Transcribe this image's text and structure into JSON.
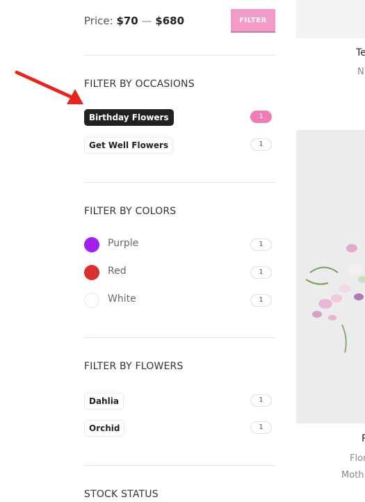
{
  "price_filter": {
    "label": "Price:",
    "min": "$70",
    "dash": "—",
    "max": "$680",
    "button_label": "FILTER"
  },
  "occasions": {
    "title": "FILTER BY OCCASIONS",
    "items": [
      {
        "label": "Birthday Flowers",
        "count": "1",
        "active": true
      },
      {
        "label": "Get Well Flowers",
        "count": "1",
        "active": false
      }
    ]
  },
  "colors": {
    "title": "FILTER BY COLORS",
    "items": [
      {
        "label": "Purple",
        "count": "1",
        "swatch": "#a020f0"
      },
      {
        "label": "Red",
        "count": "1",
        "swatch": "#d93030"
      },
      {
        "label": "White",
        "count": "1",
        "swatch": "#ffffff"
      }
    ]
  },
  "flowers": {
    "title": "FILTER BY FLOWERS",
    "items": [
      {
        "label": "Dahlia",
        "count": "1"
      },
      {
        "label": "Orchid",
        "count": "1"
      }
    ]
  },
  "stock": {
    "title": "STOCK STATUS"
  },
  "products": {
    "first_name": "Te",
    "first_sub": "N",
    "second_name": "P",
    "second_sub_1": "Flor",
    "second_sub_2": "Moth"
  },
  "colors_theme": {
    "accent_pink": "#f07cb5",
    "filter_button": "#f29ac8",
    "active_tag": "#222222",
    "arrow": "#e5261c"
  }
}
